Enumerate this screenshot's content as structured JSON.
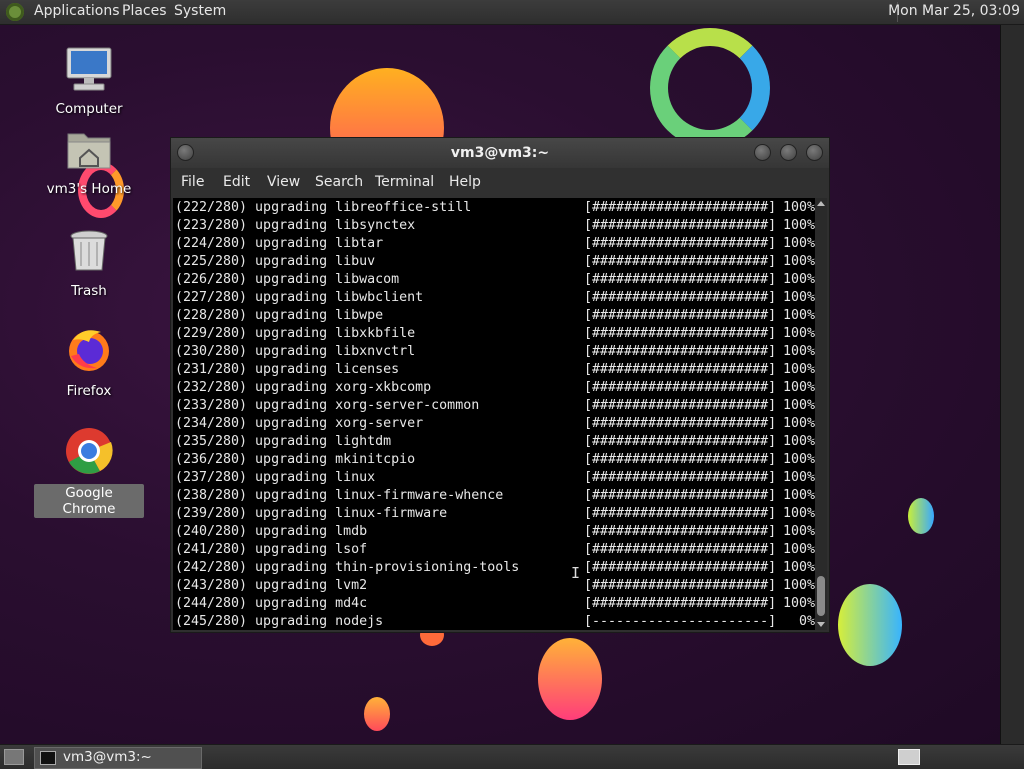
{
  "top_panel": {
    "menus": [
      "Applications",
      "Places",
      "System"
    ],
    "clock": "Mon Mar 25, 03:09"
  },
  "desktop_icons": [
    {
      "label": "Computer",
      "icon": "computer-icon"
    },
    {
      "label": "vm3's Home",
      "icon": "home-folder-icon"
    },
    {
      "label": "Trash",
      "icon": "trash-icon"
    },
    {
      "label": "Firefox",
      "icon": "firefox-icon"
    },
    {
      "label": "Google Chrome",
      "icon": "chrome-icon",
      "selected": true
    }
  ],
  "terminal": {
    "title": "vm3@vm3:~",
    "menu": [
      "File",
      "Edit",
      "View",
      "Search",
      "Terminal",
      "Help"
    ],
    "lines": [
      {
        "desc": "(222/280) upgrading libreoffice-still",
        "bar": "[######################]",
        "pct": "100%"
      },
      {
        "desc": "(223/280) upgrading libsynctex",
        "bar": "[######################]",
        "pct": "100%"
      },
      {
        "desc": "(224/280) upgrading libtar",
        "bar": "[######################]",
        "pct": "100%"
      },
      {
        "desc": "(225/280) upgrading libuv",
        "bar": "[######################]",
        "pct": "100%"
      },
      {
        "desc": "(226/280) upgrading libwacom",
        "bar": "[######################]",
        "pct": "100%"
      },
      {
        "desc": "(227/280) upgrading libwbclient",
        "bar": "[######################]",
        "pct": "100%"
      },
      {
        "desc": "(228/280) upgrading libwpe",
        "bar": "[######################]",
        "pct": "100%"
      },
      {
        "desc": "(229/280) upgrading libxkbfile",
        "bar": "[######################]",
        "pct": "100%"
      },
      {
        "desc": "(230/280) upgrading libxnvctrl",
        "bar": "[######################]",
        "pct": "100%"
      },
      {
        "desc": "(231/280) upgrading licenses",
        "bar": "[######################]",
        "pct": "100%"
      },
      {
        "desc": "(232/280) upgrading xorg-xkbcomp",
        "bar": "[######################]",
        "pct": "100%"
      },
      {
        "desc": "(233/280) upgrading xorg-server-common",
        "bar": "[######################]",
        "pct": "100%"
      },
      {
        "desc": "(234/280) upgrading xorg-server",
        "bar": "[######################]",
        "pct": "100%"
      },
      {
        "desc": "(235/280) upgrading lightdm",
        "bar": "[######################]",
        "pct": "100%"
      },
      {
        "desc": "(236/280) upgrading mkinitcpio",
        "bar": "[######################]",
        "pct": "100%"
      },
      {
        "desc": "(237/280) upgrading linux",
        "bar": "[######################]",
        "pct": "100%"
      },
      {
        "desc": "(238/280) upgrading linux-firmware-whence",
        "bar": "[######################]",
        "pct": "100%"
      },
      {
        "desc": "(239/280) upgrading linux-firmware",
        "bar": "[######################]",
        "pct": "100%"
      },
      {
        "desc": "(240/280) upgrading lmdb",
        "bar": "[######################]",
        "pct": "100%"
      },
      {
        "desc": "(241/280) upgrading lsof",
        "bar": "[######################]",
        "pct": "100%"
      },
      {
        "desc": "(242/280) upgrading thin-provisioning-tools",
        "bar": "[######################]",
        "pct": "100%"
      },
      {
        "desc": "(243/280) upgrading lvm2",
        "bar": "[######################]",
        "pct": "100%"
      },
      {
        "desc": "(244/280) upgrading md4c",
        "bar": "[######################]",
        "pct": "100%"
      },
      {
        "desc": "(245/280) upgrading nodejs",
        "bar": "[----------------------]",
        "pct": "0%"
      }
    ]
  },
  "taskbar": {
    "task_label": "vm3@vm3:~"
  }
}
